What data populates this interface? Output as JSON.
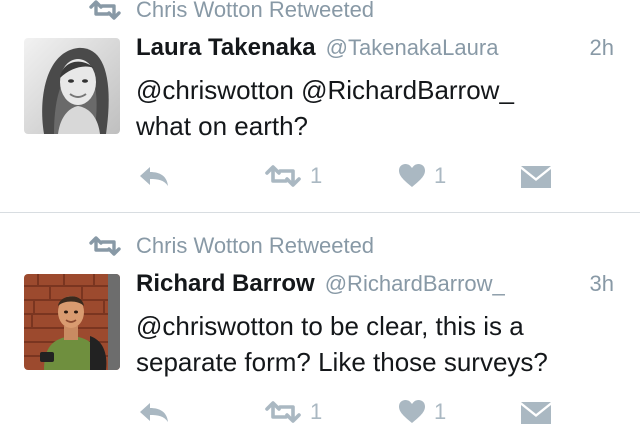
{
  "tweets": [
    {
      "retweeted_by": "Chris Wotton Retweeted",
      "name": "Laura Takenaka",
      "handle": "@TakenakaLaura",
      "time": "2h",
      "text_lines": [
        "@chriswotton @RichardBarrow_",
        "what on earth?"
      ],
      "retweet_count": "1",
      "like_count": "1",
      "icons": [
        "retweet-icon",
        "reply-icon",
        "retweet-icon",
        "heart-icon",
        "envelope-icon"
      ]
    },
    {
      "retweeted_by": "Chris Wotton Retweeted",
      "name": "Richard Barrow",
      "handle": "@RichardBarrow_",
      "time": "3h",
      "text_lines": [
        "@chriswotton to be clear, this is a",
        "separate form? Like those surveys?"
      ],
      "retweet_count": "1",
      "like_count": "1",
      "icons": [
        "retweet-icon",
        "reply-icon",
        "retweet-icon",
        "heart-icon",
        "envelope-icon"
      ]
    }
  ],
  "colors": {
    "text": "#14171a",
    "secondary": "#8899a6",
    "action_icon": "#aab8c2",
    "divider": "#d8dde1",
    "background": "#ffffff"
  }
}
